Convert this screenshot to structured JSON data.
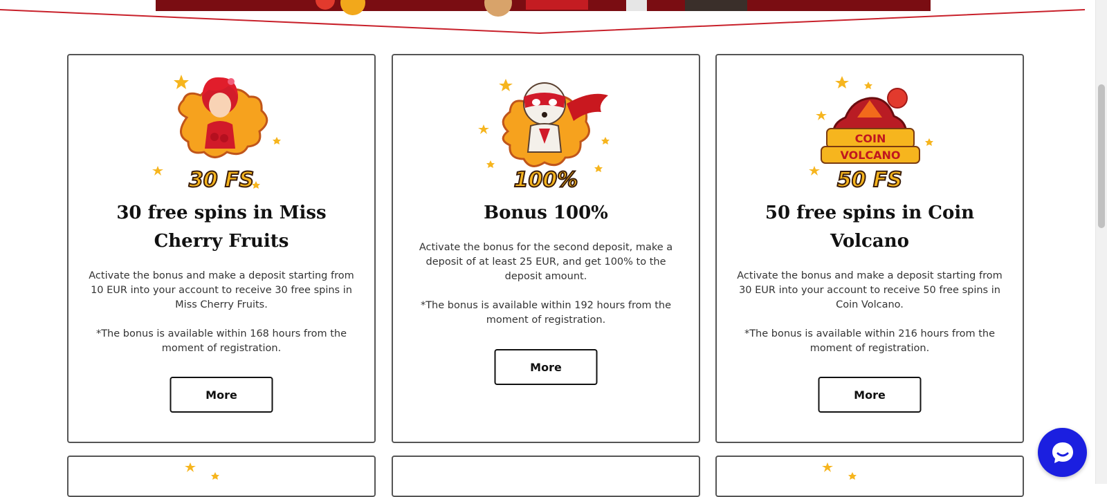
{
  "colors": {
    "accent_red": "#c8202a",
    "card_border": "#555555",
    "chat_blue": "#1b1fe0",
    "badge_yellow": "#f6b51e"
  },
  "cards": [
    {
      "badge": "30 FS",
      "title": "30 free spins in Miss Cherry Fruits",
      "description": "Activate the bonus and make a deposit starting from 10 EUR into your account to receive 30 free spins in Miss Cherry Fruits.",
      "note": "*The bonus is available within 168 hours from the moment of registration.",
      "button_label": "More"
    },
    {
      "badge": "100%",
      "title": "Bonus 100%",
      "description": "Activate the bonus for the second deposit, make a deposit of at least 25 EUR, and get 100% to the deposit amount.",
      "note": "*The bonus is available within 192 hours from the moment of registration.",
      "button_label": "More"
    },
    {
      "badge": "50 FS",
      "logo_line1": "COIN",
      "logo_line2": "VOLCANO",
      "title": "50 free spins in Coin Volcano",
      "description": "Activate the bonus and make a deposit starting from 30 EUR into your account to receive 50 free spins in Coin Volcano.",
      "note": "*The bonus is available within 216 hours from the moment of registration.",
      "button_label": "More"
    }
  ],
  "icons": {
    "chat": "chat-bubble-icon",
    "star": "star-icon"
  }
}
